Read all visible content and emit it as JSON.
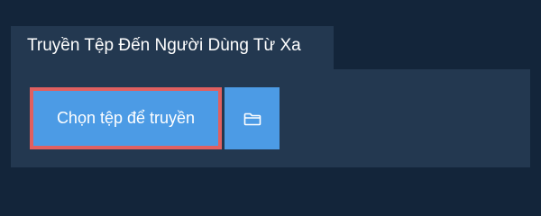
{
  "tab": {
    "title": "Truyền Tệp Đến Người Dùng Từ Xa"
  },
  "upload": {
    "choose_label": "Chọn tệp để truyền",
    "folder_icon": "folder-icon"
  },
  "colors": {
    "background": "#13253a",
    "panel": "#233850",
    "button": "#4c9be5",
    "highlight_border": "#e06060",
    "text": "#ffffff"
  }
}
